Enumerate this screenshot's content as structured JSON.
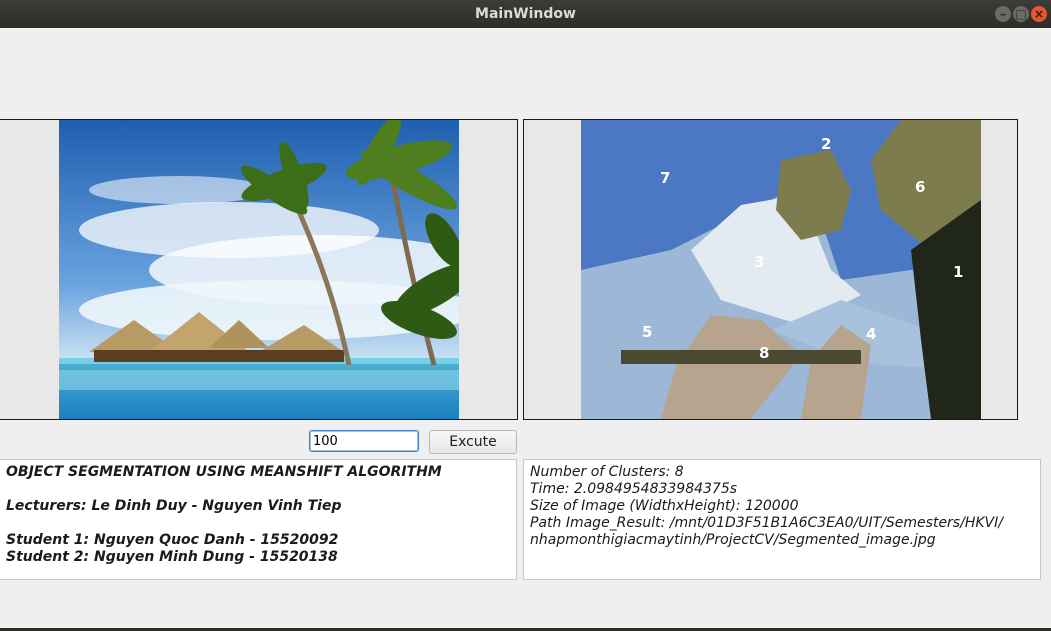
{
  "window": {
    "title": "MainWindow"
  },
  "original_image": {},
  "segmented_image": {
    "cluster_labels": [
      "1",
      "2",
      "3",
      "4",
      "5",
      "6",
      "7",
      "8"
    ]
  },
  "controls": {
    "iterations_value": "100",
    "excute_label": "Excute"
  },
  "info": {
    "title": "OBJECT SEGMENTATION USING MEANSHIFT ALGORITHM",
    "lecturers": "Lecturers: Le Dinh Duy - Nguyen Vinh Tiep",
    "student1": "Student 1: Nguyen Quoc Danh - 15520092",
    "student2": "Student 2: Nguyen Minh Dung - 15520138"
  },
  "result": {
    "clusters": "Number of Clusters: 8",
    "time": "Time: 2.0984954833984375s",
    "size": "Size of Image (WidthxHeight): 120000",
    "path_line1": "Path Image_Result: /mnt/01D3F51B1A6C3EA0/UIT/Semesters/HKVI/",
    "path_line2": "nhapmonthigiacmaytinh/ProjectCV/Segmented_image.jpg"
  }
}
